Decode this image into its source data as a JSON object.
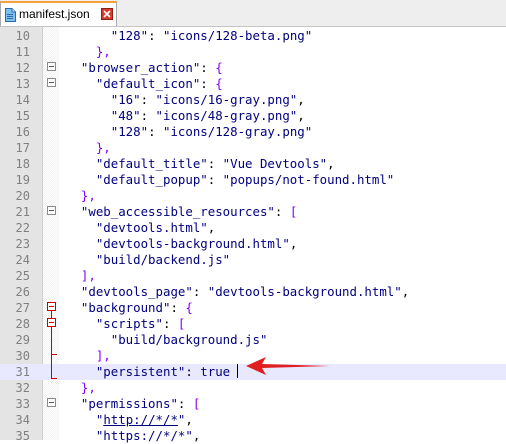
{
  "tab": {
    "label": "manifest.json"
  },
  "colors": {
    "tab_accent": "#f7a13a",
    "fold_marker": "#c80000",
    "current_line": "#e8e8ff",
    "arrow": "#e02020"
  },
  "lines": [
    {
      "num": "10",
      "html": "      <span class=\"s\">\"128\"</span>: <span class=\"s\">\"icons/128-beta.png\"</span>"
    },
    {
      "num": "11",
      "html": "    <span class=\"p\">},</span>"
    },
    {
      "num": "12",
      "html": "  <span class=\"s\">\"browser_action\"</span>: <span class=\"p\">{</span>"
    },
    {
      "num": "13",
      "html": "    <span class=\"s\">\"default_icon\"</span>: <span class=\"p\">{</span>"
    },
    {
      "num": "14",
      "html": "      <span class=\"s\">\"16\"</span>: <span class=\"s\">\"icons/16-gray.png\"</span>,"
    },
    {
      "num": "15",
      "html": "      <span class=\"s\">\"48\"</span>: <span class=\"s\">\"icons/48-gray.png\"</span>,"
    },
    {
      "num": "16",
      "html": "      <span class=\"s\">\"128\"</span>: <span class=\"s\">\"icons/128-gray.png\"</span>"
    },
    {
      "num": "17",
      "html": "    <span class=\"p\">},</span>"
    },
    {
      "num": "18",
      "html": "    <span class=\"s\">\"default_title\"</span>: <span class=\"s\">\"Vue Devtools\"</span>,"
    },
    {
      "num": "19",
      "html": "    <span class=\"s\">\"default_popup\"</span>: <span class=\"s\">\"popups/not-found.html\"</span>"
    },
    {
      "num": "20",
      "html": "  <span class=\"p\">},</span>"
    },
    {
      "num": "21",
      "html": "  <span class=\"s\">\"web_accessible_resources\"</span>: <span class=\"p\">[</span>"
    },
    {
      "num": "22",
      "html": "    <span class=\"s\">\"devtools.html\"</span>,"
    },
    {
      "num": "23",
      "html": "    <span class=\"s\">\"devtools-background.html\"</span>,"
    },
    {
      "num": "24",
      "html": "    <span class=\"s\">\"build/backend.js\"</span>"
    },
    {
      "num": "25",
      "html": "  <span class=\"p\">],</span>"
    },
    {
      "num": "26",
      "html": "  <span class=\"s\">\"devtools_page\"</span>: <span class=\"s\">\"devtools-background.html\"</span>,"
    },
    {
      "num": "27",
      "html": "  <span class=\"s\">\"background\"</span>: <span class=\"p\">{</span>"
    },
    {
      "num": "28",
      "html": "    <span class=\"s\">\"scripts\"</span>: <span class=\"p\">[</span>"
    },
    {
      "num": "29",
      "html": "      <span class=\"s\">\"build/background.js\"</span>"
    },
    {
      "num": "30",
      "html": "    <span class=\"p\">],</span>"
    },
    {
      "num": "31",
      "html": "    <span class=\"s\">\"persistent\"</span>: <span class=\"kw\">true</span>"
    },
    {
      "num": "32",
      "html": "  <span class=\"p\">},</span>"
    },
    {
      "num": "33",
      "html": "  <span class=\"s\">\"permissions\"</span>: <span class=\"p\">[</span>"
    },
    {
      "num": "34",
      "html": "    <span class=\"s\">\"<span class=\"u\">http://*/*</span>\"</span>,"
    },
    {
      "num": "35",
      "html": "    <span class=\"s\">\"https://*/*\"</span>,"
    }
  ]
}
